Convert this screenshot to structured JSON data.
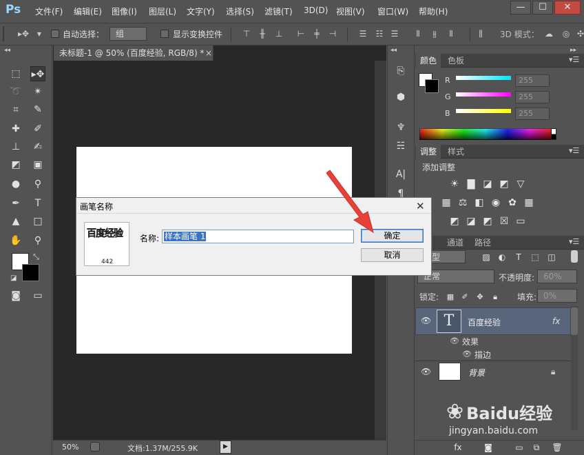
{
  "app": {
    "logo": "Ps",
    "menu": [
      "文件(F)",
      "编辑(E)",
      "图像(I)",
      "图层(L)",
      "文字(Y)",
      "选择(S)",
      "滤镜(T)",
      "3D(D)",
      "视图(V)",
      "窗口(W)",
      "帮助(H)"
    ],
    "window_buttons": {
      "minimize": "—",
      "maximize": "☐",
      "close": "✕"
    }
  },
  "options_bar": {
    "auto_select_label": "自动选择：",
    "auto_select_value": "组",
    "show_transform_label": "显示变换控件",
    "mode_label": "3D 模式："
  },
  "document": {
    "tab_title": "未标题-1 @ 50% (百度经验, RGB/8) *",
    "tab_close": "×",
    "zoom": "50%",
    "doc_info": "文档:1.37M/255.9K"
  },
  "panels": {
    "color_tabs": [
      "颜色",
      "色板"
    ],
    "rgb": [
      {
        "label": "R",
        "value": "255",
        "color": "#00e5ff"
      },
      {
        "label": "G",
        "value": "255",
        "color": "#ff00ff"
      },
      {
        "label": "B",
        "value": "255",
        "color": "#ffff00"
      }
    ],
    "adjust_tabs": [
      "调整",
      "样式"
    ],
    "adjust_title": "添加调整",
    "layers_tabs": [
      "层",
      "通道",
      "路径"
    ],
    "kind_label": "类型",
    "blend_mode": "正常",
    "opacity_label": "不透明度:",
    "opacity_value": "60%",
    "lock_label": "锁定:",
    "fill_label": "填充:",
    "fill_value": "0%",
    "layers": [
      {
        "name": "百度经验",
        "badge": "fx",
        "thumb": "T"
      },
      {
        "name": "效果"
      },
      {
        "name": "描边"
      },
      {
        "name": "背景"
      }
    ]
  },
  "dialog": {
    "title": "画笔名称",
    "close": "✕",
    "preview_text": "百度经验",
    "preview_size": "442",
    "name_label": "名称:",
    "name_value": "样本画笔 1",
    "ok": "确定",
    "cancel": "取消"
  },
  "watermark": {
    "brand": "Baidu经验",
    "url": "jingyan.baidu.com"
  },
  "colors": {
    "accent_red": "#e8413a",
    "selection": "#3a72c4"
  }
}
